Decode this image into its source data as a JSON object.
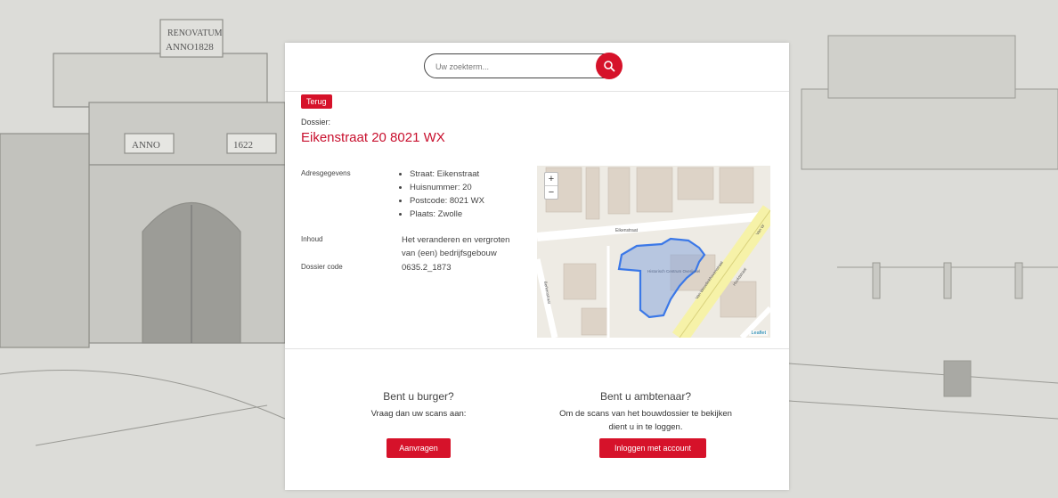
{
  "search": {
    "placeholder": "Uw zoekterm..."
  },
  "back_label": "Terug",
  "dossier": {
    "label": "Dossier:",
    "title": "Eikenstraat 20 8021 WX"
  },
  "details": {
    "address_label": "Adresgegevens",
    "address_items": [
      "Straat: Eikenstraat",
      "Huisnummer: 20",
      "Postcode: 8021 WX",
      "Plaats: Zwolle"
    ],
    "content_label": "Inhoud",
    "content_value": "Het veranderen en vergroten van (een) bedrijfsgebouw",
    "code_label": "Dossier code",
    "code_value": "0635.2_1873"
  },
  "map": {
    "zoom_in": "+",
    "zoom_out": "−",
    "attribution": "Leaflet",
    "street_labels": [
      "Eikenstraat",
      "Van Wevelinkhovenstraat",
      "Berkenstraat",
      "Hoofdstraat",
      "Van W"
    ],
    "building_label": "Historisch Centrum Overijssel"
  },
  "citizen": {
    "heading": "Bent u burger?",
    "text": "Vraag dan uw scans aan:",
    "button": "Aanvragen"
  },
  "official": {
    "heading": "Bent u ambtenaar?",
    "text": "Om de scans van het bouwdossier te bekijken dient u in te loggen.",
    "button": "Inloggen met account"
  },
  "background": {
    "sign_line1": "RENOVATUM",
    "sign_line2": "ANNO1828",
    "anno_left": "ANNO",
    "anno_right": "1622"
  },
  "colors": {
    "accent": "#d6122a",
    "title": "#c8102e",
    "polygon": "#3b78e7"
  }
}
